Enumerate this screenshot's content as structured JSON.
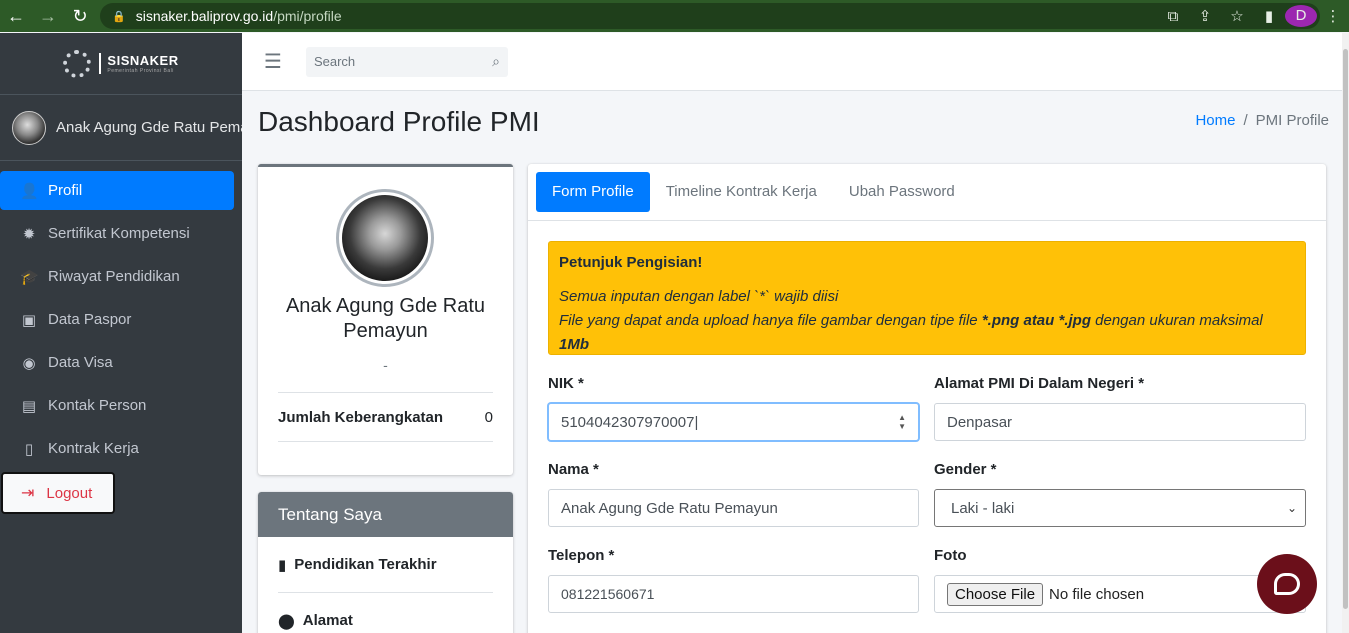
{
  "browser": {
    "url_host": "sisnaker.baliprov.go.id",
    "url_path": "/pmi/profile",
    "profile_initial": "D"
  },
  "brand": {
    "name": "SISNAKER",
    "subtitle": "Pemerintah Provinsi Bali"
  },
  "user": {
    "name": "Anak Agung Gde Ratu Pemayun"
  },
  "sidebar": {
    "items": [
      {
        "label": "Profil",
        "icon": "user-icon",
        "active": true
      },
      {
        "label": "Sertifikat Kompetensi",
        "icon": "certificate-icon"
      },
      {
        "label": "Riwayat Pendidikan",
        "icon": "graduation-cap-icon"
      },
      {
        "label": "Data Paspor",
        "icon": "passport-icon"
      },
      {
        "label": "Data Visa",
        "icon": "visa-icon"
      },
      {
        "label": "Kontak Person",
        "icon": "contact-icon"
      },
      {
        "label": "Kontrak Kerja",
        "icon": "contract-icon"
      }
    ],
    "logout": "Logout"
  },
  "topnav": {
    "search_placeholder": "Search"
  },
  "header": {
    "title": "Dashboard Profile PMI",
    "breadcrumb_home": "Home",
    "breadcrumb_sep": "/",
    "breadcrumb_current": "PMI Profile"
  },
  "profile": {
    "name": "Anak Agung Gde Ratu Pemayun",
    "subtitle": "-",
    "stat_label": "Jumlah Keberangkatan",
    "stat_value": "0"
  },
  "about": {
    "title": "Tentang Saya",
    "rows": [
      "Pendidikan Terakhir",
      "Alamat"
    ]
  },
  "tabs": [
    "Form Profile",
    "Timeline Kontrak Kerja",
    "Ubah Password"
  ],
  "alert": {
    "title": "Petunjuk Pengisian!",
    "line1": "Semua inputan dengan label `*` wajib diisi",
    "line2_a": "File yang dapat anda upload hanya file gambar dengan tipe file ",
    "line2_b": "*.png atau *.jpg",
    "line2_c": " dengan ukuran maksimal ",
    "line2_d": "1Mb"
  },
  "form": {
    "nik_label": "NIK *",
    "nik_value": "5104042307970007",
    "alamat_label": "Alamat PMI Di Dalam Negeri *",
    "alamat_value": "Denpasar",
    "nama_label": "Nama *",
    "nama_value": "Anak Agung Gde Ratu Pemayun",
    "gender_label": "Gender *",
    "gender_value": "Laki - laki",
    "telepon_label": "Telepon *",
    "telepon_value": "081221560671",
    "foto_label": "Foto",
    "file_button": "Choose File",
    "file_status": "No file chosen"
  },
  "colors": {
    "primary": "#007bff",
    "sidebar": "#343a40",
    "warning": "#ffc107",
    "browser": "#2d5a27",
    "chat": "#6b0f1a"
  }
}
